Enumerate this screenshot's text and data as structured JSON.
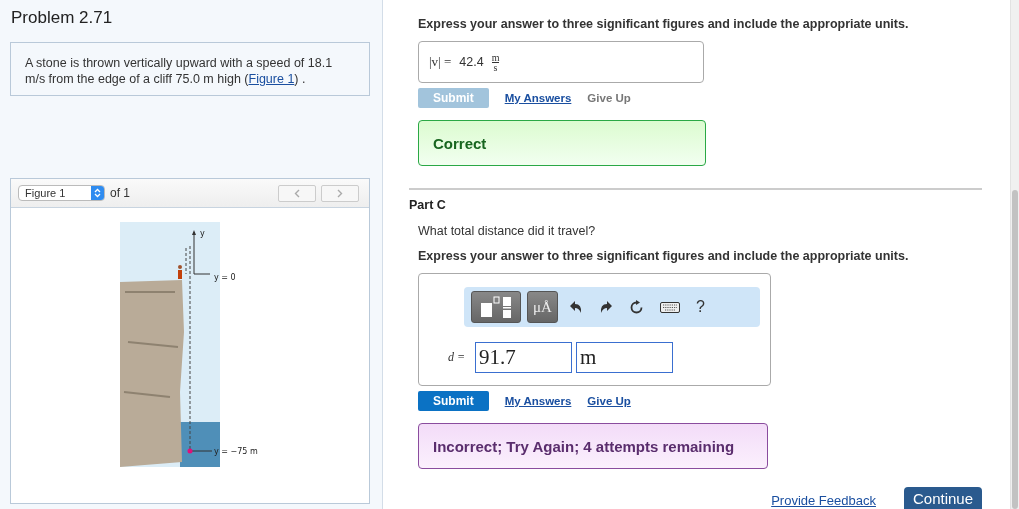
{
  "problem": {
    "title": "Problem 2.71",
    "text_before": "A stone is thrown vertically upward with a speed of 18.1 m/s from the edge of a cliff 75.0 m high (",
    "figure_link": "Figure 1",
    "text_after": ") ."
  },
  "figure": {
    "select": "Figure 1",
    "count": "of 1",
    "labels": [
      {
        "kind": "axis",
        "text": "y"
      },
      {
        "kind": "top",
        "text": "y = 0"
      },
      {
        "kind": "bottom",
        "text": "y = −75 m"
      }
    ]
  },
  "part_b": {
    "instruction": "Express your answer to three significant figures and include the appropriate units.",
    "variable": "|v| =",
    "value": "42.4",
    "unit_top": "m",
    "unit_bottom": "s",
    "submit": {
      "label": "Submit",
      "disabled": true
    },
    "my_answers": "My Answers",
    "give_up": {
      "label": "Give Up",
      "disabled": true
    },
    "feedback": {
      "kind": "correct",
      "text": "Correct"
    }
  },
  "part_c": {
    "title": "Part C",
    "question": "What total distance did it travel?",
    "instruction": "Express your answer to three significant figures and include the appropriate units.",
    "units_button": "μÅ",
    "help": "?",
    "variable": "d =",
    "value": "91.7",
    "unit": "m",
    "submit": {
      "label": "Submit",
      "disabled": false
    },
    "my_answers": "My Answers",
    "give_up": {
      "label": "Give Up",
      "disabled": false
    },
    "feedback": {
      "kind": "incorrect",
      "text": "Incorrect; Try Again; 4 attempts remaining"
    }
  },
  "footer": {
    "feedback_link": "Provide Feedback",
    "continue": "Continue"
  }
}
